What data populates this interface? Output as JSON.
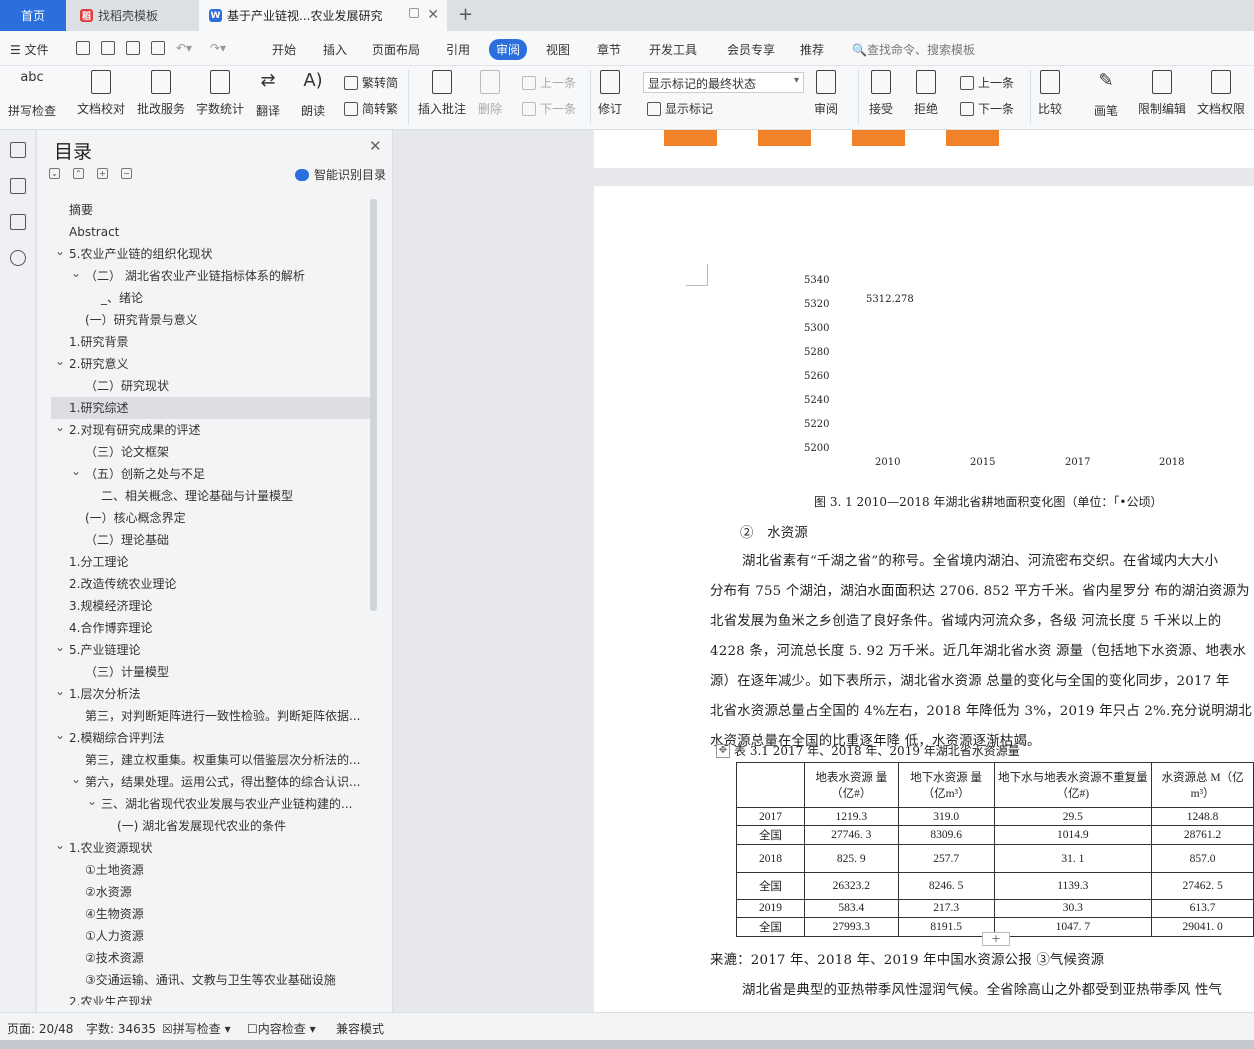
{
  "tabs": {
    "home": "首页",
    "templates": "找稻壳模板",
    "doc": "基于产业链视...农业发展研究"
  },
  "menu": {
    "file": "文件",
    "items": [
      "开始",
      "插入",
      "页面布局",
      "引用",
      "审阅",
      "视图",
      "章节",
      "开发工具",
      "会员专享",
      "推荐"
    ],
    "search": "查找命令、搜索模板"
  },
  "ribbon": {
    "spell": "拼写检查",
    "proof": "文档校对",
    "batch": "批改服务",
    "count": "字数统计",
    "translate": "翻译",
    "read": "朗读",
    "t2s": "繁转简",
    "s2t": "简转繁",
    "comment": "插入批注",
    "delete": "删除",
    "prev": "上一条",
    "next": "下一条",
    "track": "修订",
    "show_state": "显示标记的最终状态",
    "show_marks": "显示标记",
    "review": "审阅",
    "accept": "接受",
    "reject": "拒绝",
    "prev2": "上一条",
    "next2": "下一条",
    "compare": "比较",
    "pen": "画笔",
    "restrict": "限制编辑",
    "perm": "文档权限"
  },
  "panel": {
    "title": "目录",
    "smart": "智能识别目录",
    "items": [
      {
        "t": "摘要",
        "l": 0
      },
      {
        "t": "Abstract",
        "l": 0
      },
      {
        "t": "5.农业产业链的组织化现状",
        "l": 0,
        "c": 1
      },
      {
        "t": "（二） 湖北省农业产业链指标体系的解析",
        "l": 1,
        "c": 1
      },
      {
        "t": "_、绪论",
        "l": 2
      },
      {
        "t": "(一）研究背景与意义",
        "l": 1
      },
      {
        "t": "1.研究背景",
        "l": 0
      },
      {
        "t": "2.研究意义",
        "l": 0,
        "c": 1
      },
      {
        "t": "（二）研究现状",
        "l": 1
      },
      {
        "t": "1.研究综述",
        "l": 0,
        "sel": 1
      },
      {
        "t": "2.对现有研究成果的评述",
        "l": 0,
        "c": 1
      },
      {
        "t": "（三）论文框架",
        "l": 1
      },
      {
        "t": "（五）创新之处与不足",
        "l": 1,
        "c": 1
      },
      {
        "t": "二、相关概念、理论基础与计量模型",
        "l": 2
      },
      {
        "t": "(一）核心概念界定",
        "l": 1
      },
      {
        "t": "（二）理论基础",
        "l": 1
      },
      {
        "t": "1.分工理论",
        "l": 0
      },
      {
        "t": "2.改造传统农业理论",
        "l": 0
      },
      {
        "t": "3.规模经济理论",
        "l": 0
      },
      {
        "t": "4.合作博弈理论",
        "l": 0
      },
      {
        "t": "5.产业链理论",
        "l": 0,
        "c": 1
      },
      {
        "t": "（三）计量模型",
        "l": 1
      },
      {
        "t": "1.层次分析法",
        "l": 0,
        "c": 1
      },
      {
        "t": "第三，对判断矩阵进行一致性检验。判断矩阵依据...",
        "l": 1
      },
      {
        "t": "2.模糊综合评判法",
        "l": 0,
        "c": 1
      },
      {
        "t": "第三，建立权重集。权重集可以借鉴层次分析法的...",
        "l": 1
      },
      {
        "t": "第六，结果处理。运用公式，得出整体的综合认识...",
        "l": 1,
        "c": 1
      },
      {
        "t": "三、湖北省现代农业发展与农业产业链构建的...",
        "l": 2,
        "c": 1
      },
      {
        "t": "(一) 湖北省发展现代农业的条件",
        "l": 3
      },
      {
        "t": "1.农业资源现状",
        "l": 0,
        "c": 1
      },
      {
        "t": "①土地资源",
        "l": 1
      },
      {
        "t": "②水资源",
        "l": 1
      },
      {
        "t": "④生物资源",
        "l": 1
      },
      {
        "t": "①人力资源",
        "l": 1
      },
      {
        "t": "②技术资源",
        "l": 1
      },
      {
        "t": "③交通运输、通讯、文教与卫生等农业基础设施",
        "l": 1
      },
      {
        "t": "2.农业生产现状",
        "l": 0
      }
    ]
  },
  "chart_data": {
    "type": "bar",
    "yticks": [
      "5340",
      "5320",
      "5300",
      "5280",
      "5260",
      "5240",
      "5220",
      "5200"
    ],
    "categories": [
      "2010",
      "2015",
      "2017",
      "2018"
    ],
    "values": [
      5312.278,
      null,
      null,
      null
    ],
    "data_label": "5312.278",
    "ylim": [
      5200,
      5340
    ]
  },
  "doc": {
    "caption": "图 3. 1 2010—2018 年湖北省耕地面积变化图（单位：「•公顷）",
    "sub": "②　水资源",
    "lines": [
      "湖北省素有“千湖之省”的称号。全省境内湖泊、河流密布交织。在省域内大大小",
      "分布有 755 个湖泊，湖泊水面面积达 2706. 852 平方千米。省内星罗分 布的湖泊资源为",
      "北省发展为鱼米之乡创造了良好条件。省域内河流众多，各级 河流长度 5 千米以上的",
      "4228 条，河流总长度 5. 92 万千米。近几年湖北省水资 源量（包括地下水资源、地表水",
      "源）在逐年减少。如下表所示，湖北省水资源 总量的变化与全国的变化同步，2017 年",
      "北省水资源总量占全国的 4%左右，2018 年降低为 3%，2019 年只占 2%.充分说明湖北",
      "水资源总量在全国的比重逐年降 低，水资源逐渐枯竭。"
    ],
    "table_title": "表 3.1 2017 年、2018 年、2019 年湖北省水资源量",
    "headers": [
      "",
      "地表水资源 量（亿#）",
      "地下水资源 量（亿m³）",
      "地下水与地表水资源不重复量（亿#)",
      "水资源总 M（亿m³）"
    ],
    "rows": [
      [
        "2017",
        "1219.3",
        "319.0",
        "29.5",
        "1248.8"
      ],
      [
        "全国",
        "27746. 3",
        "8309.6",
        "1014.9",
        "28761.2"
      ],
      [
        "2018",
        "825. 9",
        "257.7",
        "31. 1",
        "857.0"
      ],
      [
        "全国",
        "26323.2",
        "8246. 5",
        "1139.3",
        "27462. 5"
      ],
      [
        "2019",
        "583.4",
        "217.3",
        "30.3",
        "613.7"
      ],
      [
        "全国",
        "27993.3",
        "8191.5",
        "1047. 7",
        "29041. 0"
      ]
    ],
    "source": "来漉：2017 年、2018 年、2019 年中国水资源公报 ③气候资源",
    "last": "湖北省是典型的亚热带季风性湿润气候。全省除高山之外都受到亚热带季风 性气"
  },
  "status": {
    "page": "页面: 20/48",
    "words": "字数: 34635",
    "spell": "拼写检查",
    "content": "内容检查",
    "compat": "兼容模式"
  }
}
